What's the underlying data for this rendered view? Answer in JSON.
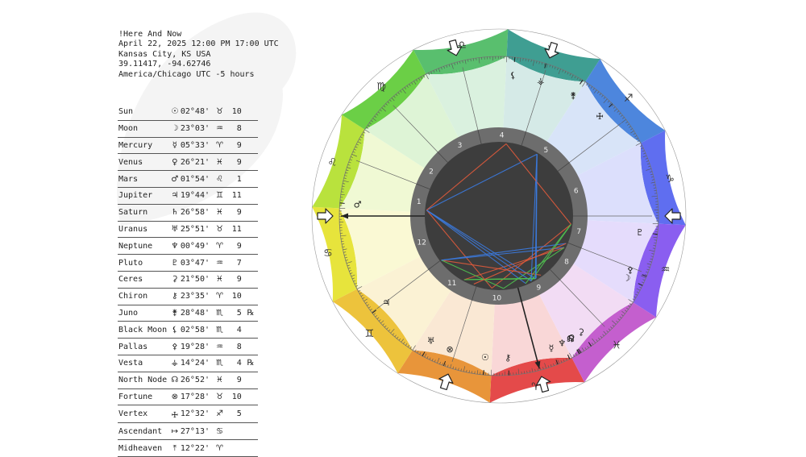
{
  "header": {
    "title": "!Here And Now",
    "datetime": "April 22, 2025 12:00 PM 17:00 UTC",
    "location": "Kansas City, KS USA",
    "coords": "39.11417, -94.62746",
    "timezone": "America/Chicago UTC -5 hours"
  },
  "planets": [
    {
      "name": "Sun",
      "glyph": "☉",
      "deg": "02°48'",
      "sign": "♉",
      "house": "10",
      "retro": ""
    },
    {
      "name": "Moon",
      "glyph": "☽",
      "deg": "23°03'",
      "sign": "♒",
      "house": "8",
      "retro": ""
    },
    {
      "name": "Mercury",
      "glyph": "☿",
      "deg": "05°33'",
      "sign": "♈",
      "house": "9",
      "retro": ""
    },
    {
      "name": "Venus",
      "glyph": "♀",
      "deg": "26°21'",
      "sign": "♓",
      "house": "9",
      "retro": ""
    },
    {
      "name": "Mars",
      "glyph": "♂",
      "deg": "01°54'",
      "sign": "♌",
      "house": "1",
      "retro": ""
    },
    {
      "name": "Jupiter",
      "glyph": "♃",
      "deg": "19°44'",
      "sign": "♊",
      "house": "11",
      "retro": ""
    },
    {
      "name": "Saturn",
      "glyph": "♄",
      "deg": "26°58'",
      "sign": "♓",
      "house": "9",
      "retro": ""
    },
    {
      "name": "Uranus",
      "glyph": "♅",
      "deg": "25°51'",
      "sign": "♉",
      "house": "11",
      "retro": ""
    },
    {
      "name": "Neptune",
      "glyph": "♆",
      "deg": "00°49'",
      "sign": "♈",
      "house": "9",
      "retro": ""
    },
    {
      "name": "Pluto",
      "glyph": "♇",
      "deg": "03°47'",
      "sign": "♒",
      "house": "7",
      "retro": ""
    },
    {
      "name": "Ceres",
      "glyph": "⚳",
      "deg": "21°50'",
      "sign": "♓",
      "house": "9",
      "retro": ""
    },
    {
      "name": "Chiron",
      "glyph": "⚷",
      "deg": "23°35'",
      "sign": "♈",
      "house": "10",
      "retro": ""
    },
    {
      "name": "Juno",
      "glyph": "⚵",
      "deg": "28°48'",
      "sign": "♏",
      "house": "5",
      "retro": "℞"
    },
    {
      "name": "Black Moon",
      "glyph": "⚸",
      "deg": "02°58'",
      "sign": "♏",
      "house": "4",
      "retro": ""
    },
    {
      "name": "Pallas",
      "glyph": "⚴",
      "deg": "19°28'",
      "sign": "♒",
      "house": "8",
      "retro": ""
    },
    {
      "name": "Vesta",
      "glyph": "⚶",
      "deg": "14°24'",
      "sign": "♏",
      "house": "4",
      "retro": "℞"
    },
    {
      "name": "North Node",
      "glyph": "☊",
      "deg": "26°52'",
      "sign": "♓",
      "house": "9",
      "retro": ""
    },
    {
      "name": "Fortune",
      "glyph": "⊗",
      "deg": "17°28'",
      "sign": "♉",
      "house": "10",
      "retro": ""
    },
    {
      "name": "Vertex",
      "glyph": "🜊",
      "deg": "12°32'",
      "sign": "♐",
      "house": "5",
      "retro": ""
    },
    {
      "name": "Ascendant",
      "glyph": "↦",
      "deg": "27°13'",
      "sign": "♋",
      "house": "",
      "retro": ""
    },
    {
      "name": "Midheaven",
      "glyph": "⤒",
      "deg": "12°22'",
      "sign": "♈",
      "house": "",
      "retro": ""
    }
  ],
  "wheel": {
    "signs": [
      {
        "glyph": "♈",
        "color": "#e44a4a"
      },
      {
        "glyph": "♉",
        "color": "#e8953a"
      },
      {
        "glyph": "♊",
        "color": "#edc33c"
      },
      {
        "glyph": "♋",
        "color": "#e7e43c"
      },
      {
        "glyph": "♌",
        "color": "#b9e23d"
      },
      {
        "glyph": "♍",
        "color": "#6bcf46"
      },
      {
        "glyph": "♎",
        "color": "#59bf6e"
      },
      {
        "glyph": "♏",
        "color": "#3f9e92"
      },
      {
        "glyph": "♐",
        "color": "#4d86dd"
      },
      {
        "glyph": "♑",
        "color": "#5f6ef0"
      },
      {
        "glyph": "♒",
        "color": "#8a5ef0"
      },
      {
        "glyph": "♓",
        "color": "#c45fce"
      }
    ],
    "ascendant_lon": 117.22,
    "midheaven_lon": 12.37,
    "house_cusps": [
      117.22,
      138.5,
      163.5,
      193.5,
      225.0,
      260.0,
      297.22,
      318.5,
      343.5,
      12.37,
      45.0,
      80.0
    ],
    "house_numbers": [
      "1",
      "2",
      "3",
      "4",
      "5",
      "6",
      "7",
      "8",
      "9",
      "10",
      "11",
      "12"
    ],
    "placements": [
      {
        "glyph": "☉",
        "lon": 32.8
      },
      {
        "glyph": "☽",
        "lon": 323.05
      },
      {
        "glyph": "☿",
        "lon": 5.55
      },
      {
        "glyph": "♀",
        "lon": 356.35
      },
      {
        "glyph": "♂",
        "lon": 121.9
      },
      {
        "glyph": "♃",
        "lon": 79.73
      },
      {
        "glyph": "♄",
        "lon": 356.97
      },
      {
        "glyph": "♅",
        "lon": 55.85
      },
      {
        "glyph": "♆",
        "lon": 0.82
      },
      {
        "glyph": "♇",
        "lon": 303.78
      },
      {
        "glyph": "⚳",
        "lon": 351.83
      },
      {
        "glyph": "⚷",
        "lon": 23.58
      },
      {
        "glyph": "⚵",
        "lon": 238.8
      },
      {
        "glyph": "⚸",
        "lon": 212.97
      },
      {
        "glyph": "⚴",
        "lon": 319.47
      },
      {
        "glyph": "⚶",
        "lon": 224.4
      },
      {
        "glyph": "☊",
        "lon": 356.87
      },
      {
        "glyph": "⊗",
        "lon": 47.47
      },
      {
        "glyph": "🜊",
        "lon": 252.53
      }
    ],
    "aspect_colors": {
      "trine": "#3b7be0",
      "square": "#e05a3b",
      "sextile": "#4fc24f",
      "quincunx": "#e0b93b"
    }
  }
}
